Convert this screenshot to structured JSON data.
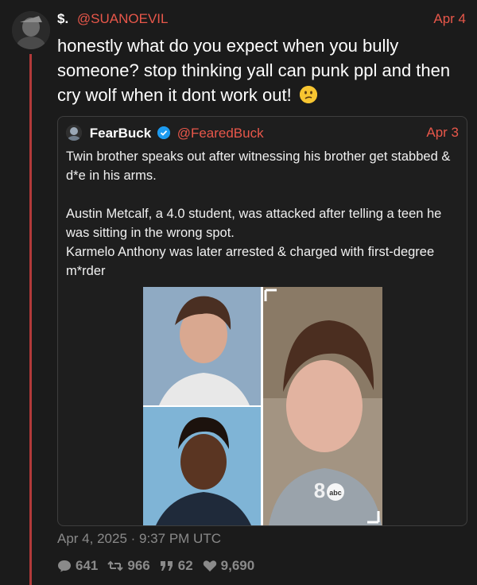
{
  "author": {
    "display_name": "$.",
    "handle": "@SUANOEVIL",
    "date": "Apr 4"
  },
  "tweet": {
    "text": "honestly what do you expect when you bully someone? stop thinking yall can punk ppl and then cry wolf when it dont work out!",
    "emoji_icon": "confused-face-emoji"
  },
  "quoted": {
    "display_name": "FearBuck",
    "handle": "@FearedBuck",
    "date": "Apr 3",
    "paragraph1": "Twin brother speaks out after witnessing his brother get stabbed & d*e in his arms.",
    "paragraph2_line1": "Austin Metcalf, a 4.0 student, was attacked after telling a teen he was sitting in the wrong spot.",
    "paragraph2_line2": "Karmelo Anthony was later arrested & charged with first-degree m*rder",
    "media_watermark": "abc"
  },
  "footer": {
    "timestamp": "Apr 4, 2025 · 9:37 PM UTC",
    "replies": "641",
    "retweets": "966",
    "quotes": "62",
    "likes": "9,690"
  },
  "colors": {
    "accent": "#e8574a",
    "thread_line": "#b23a3a",
    "background": "#1b1b1b",
    "muted": "#8a8a8a"
  }
}
